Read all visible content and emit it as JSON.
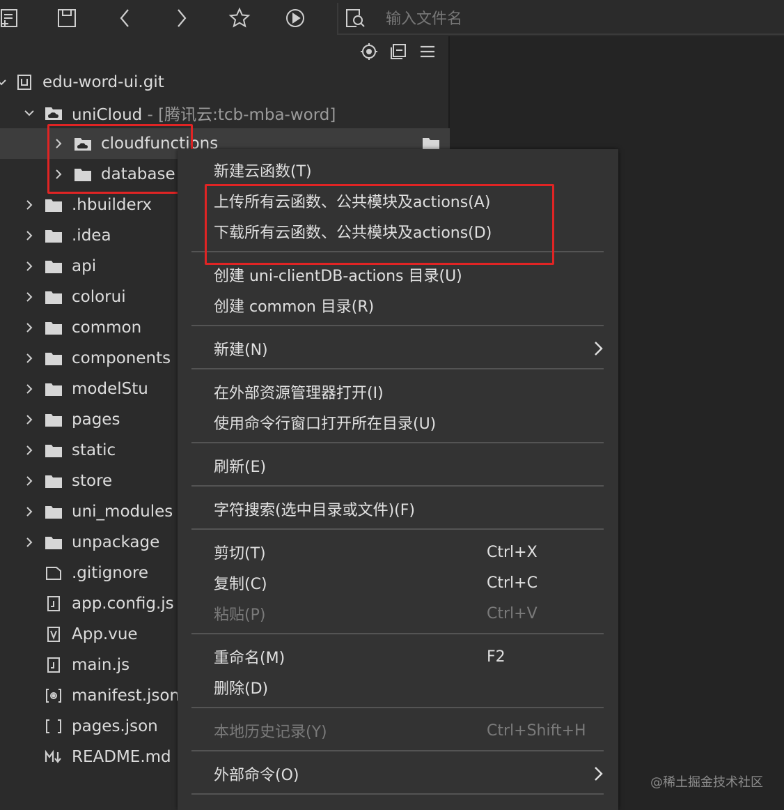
{
  "toolbar": {
    "search_placeholder": "输入文件名",
    "icons": [
      "new-file-icon",
      "save-icon",
      "back-icon",
      "forward-icon",
      "star-icon",
      "run-icon",
      "file-search-icon"
    ]
  },
  "sidebar": {
    "tools": [
      "locate-icon",
      "collapse-icon",
      "menu-icon"
    ],
    "tree": [
      {
        "label": "edu-word-ui.git",
        "sub": "",
        "expanded": true,
        "type": "project"
      },
      {
        "label": "uniCloud",
        "sub": " - [腾讯云:tcb-mba-word]",
        "expanded": true,
        "type": "cloud-folder"
      },
      {
        "label": "cloudfunctions",
        "sub": "",
        "expanded": false,
        "type": "cloud-folder"
      },
      {
        "label": "database",
        "sub": "",
        "expanded": false,
        "type": "folder"
      },
      {
        "label": ".hbuilderx",
        "type": "folder"
      },
      {
        "label": ".idea",
        "type": "folder"
      },
      {
        "label": "api",
        "type": "folder"
      },
      {
        "label": "colorui",
        "type": "folder"
      },
      {
        "label": "common",
        "type": "folder"
      },
      {
        "label": "components",
        "type": "folder"
      },
      {
        "label": "modelStu",
        "type": "folder"
      },
      {
        "label": "pages",
        "type": "folder"
      },
      {
        "label": "static",
        "type": "folder"
      },
      {
        "label": "store",
        "type": "folder"
      },
      {
        "label": "uni_modules",
        "type": "folder"
      },
      {
        "label": "unpackage",
        "type": "folder"
      },
      {
        "label": ".gitignore",
        "type": "file"
      },
      {
        "label": "app.config.js",
        "type": "js"
      },
      {
        "label": "App.vue",
        "type": "vue"
      },
      {
        "label": "main.js",
        "type": "js"
      },
      {
        "label": "manifest.json",
        "type": "manifest"
      },
      {
        "label": "pages.json",
        "type": "json"
      },
      {
        "label": "README.md",
        "type": "md"
      }
    ]
  },
  "menu": {
    "items": [
      {
        "label": "新建云函数(T)",
        "shortcut": "",
        "disabled": false,
        "submenu": false
      },
      {
        "label": "上传所有云函数、公共模块及actions(A)",
        "shortcut": "",
        "disabled": false,
        "submenu": false
      },
      {
        "label": "下载所有云函数、公共模块及actions(D)",
        "shortcut": "",
        "disabled": false,
        "submenu": false
      },
      {
        "label": "创建 uni-clientDB-actions 目录(U)",
        "shortcut": "",
        "disabled": false,
        "submenu": false
      },
      {
        "label": "创建 common 目录(R)",
        "shortcut": "",
        "disabled": false,
        "submenu": false
      },
      {
        "label": "新建(N)",
        "shortcut": "",
        "disabled": false,
        "submenu": true
      },
      {
        "label": "在外部资源管理器打开(I)",
        "shortcut": "",
        "disabled": false,
        "submenu": false
      },
      {
        "label": "使用命令行窗口打开所在目录(U)",
        "shortcut": "",
        "disabled": false,
        "submenu": false
      },
      {
        "label": "刷新(E)",
        "shortcut": "",
        "disabled": false,
        "submenu": false
      },
      {
        "label": "字符搜索(选中目录或文件)(F)",
        "shortcut": "",
        "disabled": false,
        "submenu": false
      },
      {
        "label": "剪切(T)",
        "shortcut": "Ctrl+X",
        "disabled": false,
        "submenu": false
      },
      {
        "label": "复制(C)",
        "shortcut": "Ctrl+C",
        "disabled": false,
        "submenu": false
      },
      {
        "label": "粘贴(P)",
        "shortcut": "Ctrl+V",
        "disabled": true,
        "submenu": false
      },
      {
        "label": "重命名(M)",
        "shortcut": "F2",
        "disabled": false,
        "submenu": false
      },
      {
        "label": "删除(D)",
        "shortcut": "",
        "disabled": false,
        "submenu": false
      },
      {
        "label": "本地历史记录(Y)",
        "shortcut": "Ctrl+Shift+H",
        "disabled": true,
        "submenu": false
      },
      {
        "label": "外部命令(O)",
        "shortcut": "",
        "disabled": false,
        "submenu": true
      }
    ]
  },
  "watermark": "@稀土掘金技术社区",
  "colors": {
    "highlight": "#e02424",
    "menu_bg": "#333333",
    "sidebar_bg": "#2b2b2b"
  }
}
